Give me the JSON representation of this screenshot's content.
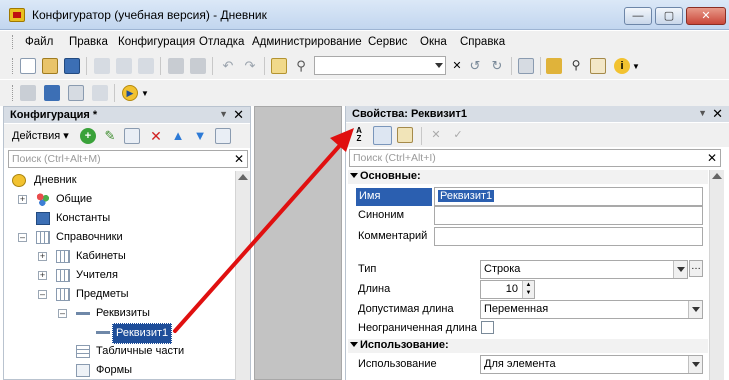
{
  "window": {
    "title": "Конфигуратор (учебная версия) - Дневник"
  },
  "menu": {
    "items": [
      "Файл",
      "Правка",
      "Конфигурация",
      "Отладка",
      "Администрирование",
      "Сервис",
      "Окна",
      "Справка"
    ]
  },
  "toolbar": {
    "search_value": ""
  },
  "left_panel": {
    "title": "Конфигурация *",
    "actions_label": "Действия",
    "search_placeholder": "Поиск (Ctrl+Alt+M)",
    "tree": [
      {
        "label": "Дневник",
        "icon": "config-root-icon"
      },
      {
        "label": "Общие",
        "icon": "common-icon"
      },
      {
        "label": "Константы",
        "icon": "constants-icon"
      },
      {
        "label": "Справочники",
        "icon": "catalogs-icon"
      },
      {
        "label": "Кабинеты",
        "icon": "catalog-icon"
      },
      {
        "label": "Учителя",
        "icon": "catalog-icon"
      },
      {
        "label": "Предметы",
        "icon": "catalog-icon"
      },
      {
        "label": "Реквизиты",
        "icon": "attributes-icon"
      },
      {
        "label": "Реквизит1",
        "icon": "attribute-icon",
        "selected": true
      },
      {
        "label": "Табличные части",
        "icon": "tabular-section-icon"
      },
      {
        "label": "Формы",
        "icon": "forms-icon"
      }
    ]
  },
  "right_panel": {
    "title": "Свойства: Реквизит1",
    "search_placeholder": "Поиск (Ctrl+Alt+I)",
    "sections": {
      "basic": "Основные:",
      "usage": "Использование:"
    },
    "properties": {
      "name_label": "Имя",
      "name_value": "Реквизит1",
      "synonym_label": "Синоним",
      "synonym_value": "",
      "comment_label": "Комментарий",
      "comment_value": "",
      "type_label": "Тип",
      "type_value": "Строка",
      "length_label": "Длина",
      "length_value": "10",
      "allowed_length_label": "Допустимая длина",
      "allowed_length_value": "Переменная",
      "unlimited_length_label": "Неограниченная длина",
      "unlimited_length_checked": false,
      "usage_label": "Использование",
      "usage_value": "Для элемента"
    }
  },
  "colors": {
    "accent_selection": "#1e4e9a",
    "annotation_arrow": "#e01010"
  }
}
